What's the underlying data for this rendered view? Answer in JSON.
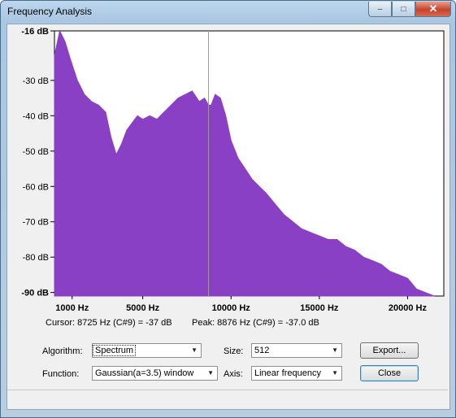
{
  "window": {
    "title": "Frequency Analysis",
    "minimize_glyph": "–",
    "maximize_glyph": "□",
    "close_glyph": "✕"
  },
  "plot": {
    "fill_color": "#8a40c4",
    "cursor_color": "#9a9a9a",
    "y_labels": [
      "-16 dB",
      "-30 dB",
      "-40 dB",
      "-50 dB",
      "-60 dB",
      "-70 dB",
      "-80 dB",
      "-90 dB"
    ],
    "x_labels": [
      "1000 Hz",
      "5000 Hz",
      "10000 Hz",
      "15000 Hz",
      "20000 Hz"
    ]
  },
  "chart_data": {
    "type": "area",
    "x_unit": "Hz",
    "y_unit": "dB",
    "xlim": [
      0,
      22050
    ],
    "ylim": [
      -91,
      -16
    ],
    "x": [
      0,
      300,
      600,
      900,
      1300,
      1700,
      2100,
      2500,
      2900,
      3200,
      3500,
      3800,
      4100,
      4400,
      4700,
      5000,
      5400,
      5800,
      6200,
      6600,
      7000,
      7400,
      7800,
      8200,
      8500,
      8725,
      8876,
      9100,
      9400,
      9700,
      10000,
      10400,
      10800,
      11200,
      11600,
      12000,
      12500,
      13000,
      13500,
      14000,
      14500,
      15000,
      15500,
      16000,
      16500,
      17000,
      17500,
      18000,
      18500,
      19000,
      19500,
      20000,
      20500,
      21000,
      21500
    ],
    "y": [
      -23,
      -16,
      -19,
      -24,
      -30,
      -34,
      -36,
      -37,
      -39,
      -46,
      -51,
      -48,
      -44,
      -42,
      -40,
      -41,
      -40,
      -41,
      -39,
      -37,
      -35,
      -34,
      -33,
      -36,
      -35,
      -37,
      -37,
      -34,
      -35,
      -40,
      -47,
      -52,
      -55,
      -58,
      -60,
      -62,
      -65,
      -68,
      -70,
      -72,
      -73,
      -74,
      -75,
      -75,
      -77,
      -78,
      -80,
      -81,
      -82,
      -84,
      -85,
      -86,
      -89,
      -90,
      -91
    ],
    "cursor_hz": 8725,
    "cursor_db": -37,
    "peak_hz": 8876,
    "peak_db": -37.0,
    "grid": false
  },
  "info": {
    "cursor_text": "Cursor: 8725 Hz (C#9) = -37 dB",
    "peak_text": "Peak: 8876 Hz (C#9) = -37.0 dB"
  },
  "controls": {
    "algorithm_label": "Algorithm:",
    "algorithm_value": "Spectrum",
    "size_label": "Size:",
    "size_value": "512",
    "export_label": "Export...",
    "function_label": "Function:",
    "function_value": "Gaussian(a=3.5) window",
    "axis_label": "Axis:",
    "axis_value": "Linear frequency",
    "close_label": "Close",
    "dropdown_glyph": "▼"
  }
}
